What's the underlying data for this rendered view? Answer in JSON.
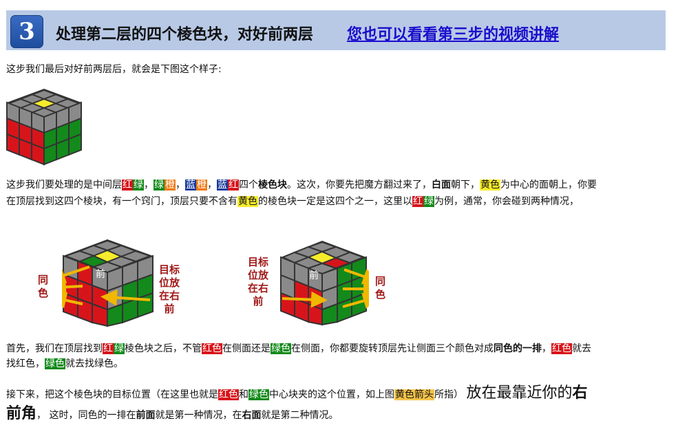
{
  "header": {
    "step_number": "3",
    "title": "处理第二层的四个棱色块，对好前两层",
    "video_link": "您也可以看看第三步的视频讲解"
  },
  "intro": "这步我们最后对好前两层后，就会是下图这个样子:",
  "para1": {
    "l1_a": "这步我们要处理的是中间层",
    "t_hong": "红",
    "t_lv": "绿",
    "sep": "，",
    "t_lv2": "绿",
    "t_cheng": "橙",
    "t_lan": "蓝",
    "t_cheng2": "橙",
    "t_lan2": "蓝",
    "t_hong2": "红",
    "l1_b": "四个",
    "l1_b2": "棱色块",
    "l1_c": "。这次，你要先把魔方翻过来了，",
    "l1_d": "白面",
    "l1_e": "朝下，",
    "l1_f": "黄色",
    "l1_g": "为中心的面朝上，你要",
    "l2_a": "在顶层找到这四个棱块，有一个窍门，顶层只要不含有",
    "l2_b": "黄色",
    "l2_c": "的棱色块一定是这四个之一，这里以",
    "l2_d1": "红",
    "l2_d2": "绿",
    "l2_e": "为例，通常，你会碰到两种情况，"
  },
  "figures": {
    "left_label": "同色",
    "left_label_chars": [
      "同",
      "色"
    ],
    "left_target_chars": [
      "目标",
      "位放",
      "在右",
      "前"
    ],
    "right_target_chars": [
      "目标",
      "位放",
      "在右",
      "前"
    ],
    "right_label_chars": [
      "同",
      "色"
    ],
    "front_text": "前"
  },
  "para2": {
    "a": "首先，我们在顶层找到",
    "b1": "红",
    "b2": "绿",
    "c": "棱色块之后，不管",
    "d": "红色",
    "e": "在侧面还是",
    "f": "绿色",
    "g": "在侧面，你都要旋转顶层先让侧面三个颜色对成",
    "h": "同色的一排",
    "i": "，",
    "j": "红色",
    "k": "就去",
    "l2_a": "找红色，",
    "l2_b": "绿色",
    "l2_c": "就去找绿色。"
  },
  "para3": {
    "a": "接下来，把这个棱色块的目标位置（在这里也就是",
    "b": "红色",
    "c": "和",
    "d": "绿色",
    "e": "中心块夹的这个位置，如上图",
    "f": "黄色箭头",
    "g": "所指）",
    "h": "放在最靠近你的",
    "i": "右",
    "l2_a": "前角",
    "l2_b": "，  这时，同色的一排在",
    "l2_c": "前面",
    "l2_d": "就是第一种情况，在",
    "l2_e": "右面",
    "l2_f": "就是第二种情况。"
  },
  "colors": {
    "header_bg": "#b8c9e6",
    "badge": "#1f4e9e",
    "link": "#1a0dcc",
    "red": "#d8141b",
    "green": "#138a1b",
    "yellow": "#f7ec2b",
    "gray": "#7a7a7a",
    "arrow": "#f0b800",
    "annotation": "#a01818"
  }
}
